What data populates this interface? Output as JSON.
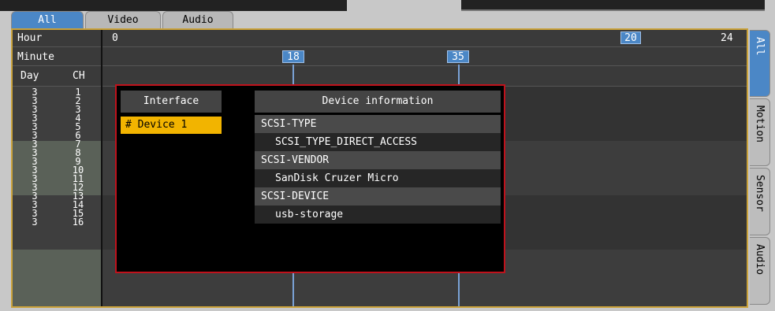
{
  "top_tabs": [
    "All",
    "Video",
    "Audio"
  ],
  "timeline": {
    "hour_label": "Hour",
    "minute_label": "Minute",
    "day_label": "Day",
    "ch_label": "CH",
    "hour_start": "0",
    "hour_mark": "20",
    "hour_end": "24",
    "minute_marks": [
      "18",
      "35"
    ]
  },
  "rows": {
    "days": [
      "3",
      "3",
      "3",
      "3",
      "3",
      "3",
      "3",
      "3",
      "3",
      "3",
      "3",
      "3",
      "3",
      "3",
      "3",
      "3"
    ],
    "channels": [
      "1",
      "2",
      "3",
      "4",
      "5",
      "6",
      "7",
      "8",
      "9",
      "10",
      "11",
      "12",
      "13",
      "14",
      "15",
      "16"
    ]
  },
  "right_tabs": [
    "All",
    "Motion",
    "Sensor",
    "Audio"
  ],
  "dialog": {
    "interface_header": "Interface",
    "device_info_header": "Device information",
    "devices": [
      "# Device 1"
    ],
    "info": [
      {
        "key": "SCSI-TYPE",
        "value": "SCSI_TYPE_DIRECT_ACCESS"
      },
      {
        "key": "SCSI-VENDOR",
        "value": "SanDisk  Cruzer Micro"
      },
      {
        "key": "SCSI-DEVICE",
        "value": "usb-storage"
      }
    ]
  },
  "colors": {
    "accent_blue": "#4b87c6",
    "selection_yellow": "#f2b400",
    "dialog_border": "#c0121c",
    "panel_border": "#caa23a"
  }
}
